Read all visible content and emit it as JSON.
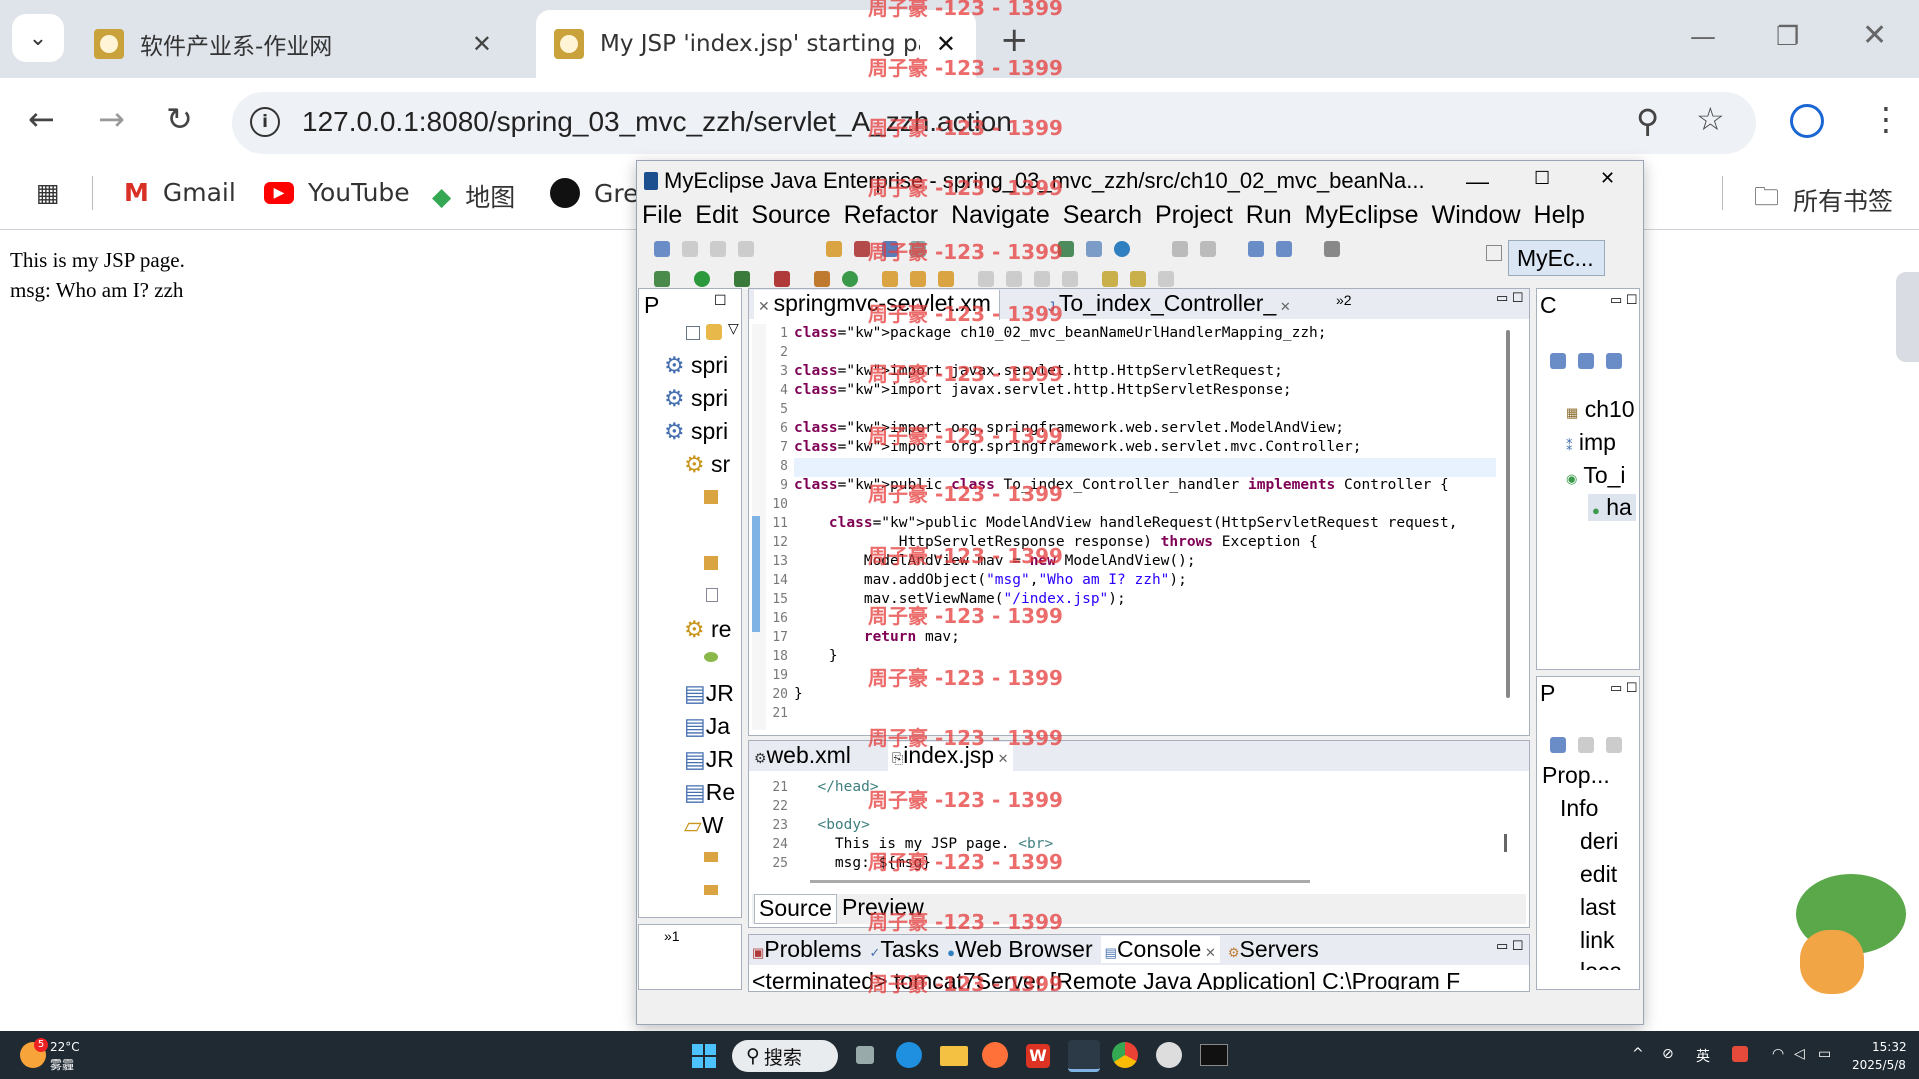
{
  "browser": {
    "tabs": [
      {
        "title": "软件产业系-作业网"
      },
      {
        "title": "My JSP 'index.jsp' starting pa"
      }
    ],
    "url": "127.0.0.1:8080/spring_03_mvc_zzh/servlet_A_zzh.action",
    "bookmarks": [
      "Gmail",
      "YouTube",
      "地图",
      "Gre"
    ],
    "all_bookmarks": "所有书签"
  },
  "page": {
    "line1": "This is my JSP page.",
    "line2": "msg: Who am I? zzh"
  },
  "ide": {
    "title": "MyEclipse Java Enterprise - spring_03_mvc_zzh/src/ch10_02_mvc_beanNa...",
    "menu": [
      "File",
      "Edit",
      "Source",
      "Refactor",
      "Navigate",
      "Search",
      "Project",
      "Run",
      "MyEclipse",
      "Window",
      "Help"
    ],
    "perspective": "MyEc...",
    "left_panel_tab": "P",
    "left_tree": [
      "spri",
      "spri",
      "spri",
      "sr",
      "re",
      "JR",
      "Ja",
      "JR",
      "Re",
      "W"
    ],
    "editor_tabs": [
      "springmvc-servlet.xm",
      "To_index_Controller_"
    ],
    "editor_overflow": "»2",
    "code_lines": [
      "package ch10_02_mvc_beanNameUrlHandlerMapping_zzh;",
      "",
      "import javax.servlet.http.HttpServletRequest;",
      "import javax.servlet.http.HttpServletResponse;",
      "",
      "import org.springframework.web.servlet.ModelAndView;",
      "import org.springframework.web.servlet.mvc.Controller;",
      "",
      "public class To_index_Controller_handler implements Controller {",
      "",
      "    public ModelAndView handleRequest(HttpServletRequest request,",
      "            HttpServletResponse response) throws Exception {",
      "        ModelAndView mav = new ModelAndView();",
      "        mav.addObject(\"msg\",\"Who am I? zzh\");",
      "        mav.setViewName(\"/index.jsp\");",
      "",
      "        return mav;",
      "    }",
      "",
      "}",
      ""
    ],
    "jsp_tabs": [
      "web.xml",
      "index.jsp"
    ],
    "jsp_lines": [
      {
        "n": "21",
        "t": "  </head>"
      },
      {
        "n": "22",
        "t": ""
      },
      {
        "n": "23",
        "t": "  <body>"
      },
      {
        "n": "24",
        "t": "    This is my JSP page. <br>"
      },
      {
        "n": "25",
        "t": "    msg: ${msg}"
      }
    ],
    "source_tabs": [
      "Source",
      "Preview"
    ],
    "bottom_tabs": [
      "Problems",
      "Tasks",
      "Web Browser",
      "Console",
      "Servers"
    ],
    "console_text": "<terminated> tomcat7Server [Remote Java Application] C:\\Program F",
    "outline_tab": "C",
    "outline_items": [
      "ch10",
      "imp",
      "To_i",
      "ha"
    ],
    "props_tab": "P",
    "props_items": [
      "Prop...",
      "Info",
      "deri",
      "edit",
      "last",
      "link",
      "loca"
    ],
    "left_bottom_tab": "»1"
  },
  "watermark": "周子豪 -123 - 1399",
  "taskbar": {
    "weather_temp": "22°C",
    "weather_desc": "雾霾",
    "search": "搜索",
    "ime": "英",
    "time": "15:32",
    "date": "2025/5/8",
    "badge": "5"
  }
}
